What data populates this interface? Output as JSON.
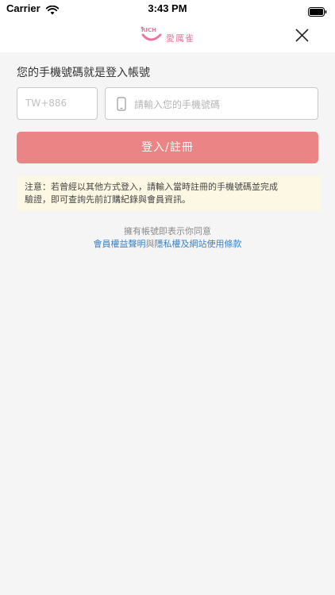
{
  "status_bar": {
    "carrier": "Carrier",
    "time": "3:43 PM",
    "wifi_icon": "wifi-icon",
    "battery_icon": "battery-icon"
  },
  "header": {
    "logo_icon": "rich-logo-icon",
    "logo_text": "愛厲雀",
    "close_icon": "close-icon",
    "brand_color": "#e8789a"
  },
  "form": {
    "prompt": "您的手機號碼就是登入帳號",
    "country_code": "TW+886",
    "phone_icon": "phone-icon",
    "phone_placeholder": "請輸入您的手機號碼",
    "submit_label": "登入/註冊",
    "submit_color": "#eb8585"
  },
  "notice": {
    "line1": "注意：若曾經以其他方式登入，請輸入當時註冊的手機號碼並完成",
    "line2": "驗證，即可查詢先前訂購紀錄與會員資訊。",
    "background": "#fdf8e4"
  },
  "terms": {
    "intro": "擁有帳號即表示你同意",
    "member_rights_link": "會員權益聲明",
    "conjunction": "與",
    "privacy_link": "隱私權及網站使用條款",
    "link_color": "#3d82c4"
  }
}
